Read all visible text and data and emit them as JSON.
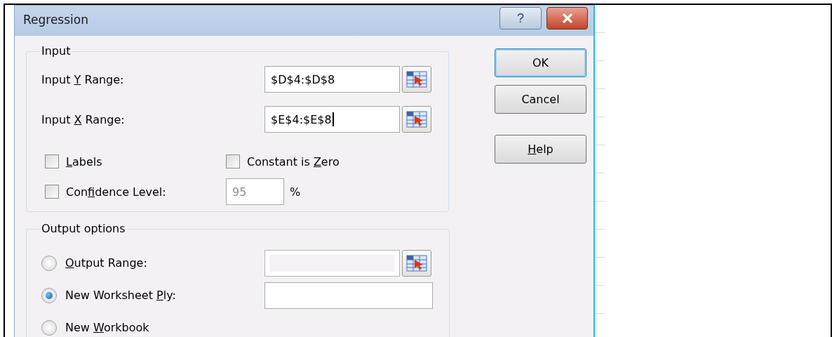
{
  "window": {
    "title": "Regression",
    "title_buttons": [
      {
        "kind": "help",
        "label": "?"
      },
      {
        "kind": "close"
      }
    ]
  },
  "input_group": {
    "legend": "Input",
    "ranges": [
      {
        "label_before": "Input ",
        "access_key": "Y",
        "label_after": " Range:",
        "value": "$D$4:$D$8",
        "focused": false
      },
      {
        "label_before": "Input ",
        "access_key": "X",
        "label_after": " Range:",
        "value": "$E$4:$E$8",
        "focused": true
      }
    ],
    "checkboxes": [
      {
        "access_key": "L",
        "label_after": "abels",
        "checked": false
      },
      {
        "label_before": "Constant is ",
        "access_key": "Z",
        "label_after": "ero",
        "checked": false
      },
      {
        "label_before": "Con",
        "access_key": "f",
        "label_after": "idence Level:",
        "checked": false
      }
    ],
    "confidence": {
      "value": "95",
      "disabled": true,
      "unit": "%"
    }
  },
  "output_group": {
    "legend": "Output options",
    "options": [
      {
        "access_key": "O",
        "label_after": "utput Range:",
        "selected": false,
        "field": {
          "kind": "range",
          "disabled": true
        }
      },
      {
        "label_before": "New Worksheet ",
        "access_key": "P",
        "label_after": "ly:",
        "selected": true,
        "field": {
          "kind": "text",
          "disabled": false
        }
      },
      {
        "label_before": "New ",
        "access_key": "W",
        "label_after": "orkbook",
        "selected": false
      }
    ]
  },
  "buttons": [
    {
      "label_before": "OK",
      "default": true
    },
    {
      "label_before": "Cancel",
      "default": false
    },
    {
      "access_key": "H",
      "label_after": "elp",
      "default": false
    }
  ]
}
